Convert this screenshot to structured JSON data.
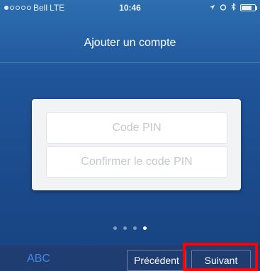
{
  "status_bar": {
    "carrier": "Bell",
    "network": "LTE",
    "time": "10:46"
  },
  "header": {
    "title": "Ajouter un compte"
  },
  "form": {
    "pin_placeholder": "Code PIN",
    "confirm_pin_placeholder": "Confirmer le code PIN"
  },
  "pager": {
    "count": 4,
    "active_index": 3
  },
  "keyboard_bar": {
    "abc_label": "ABC",
    "previous_label": "Précédent",
    "next_label": "Suivant"
  },
  "colors": {
    "highlight": "#ff0000",
    "abc_accent": "#3e8ae6"
  }
}
